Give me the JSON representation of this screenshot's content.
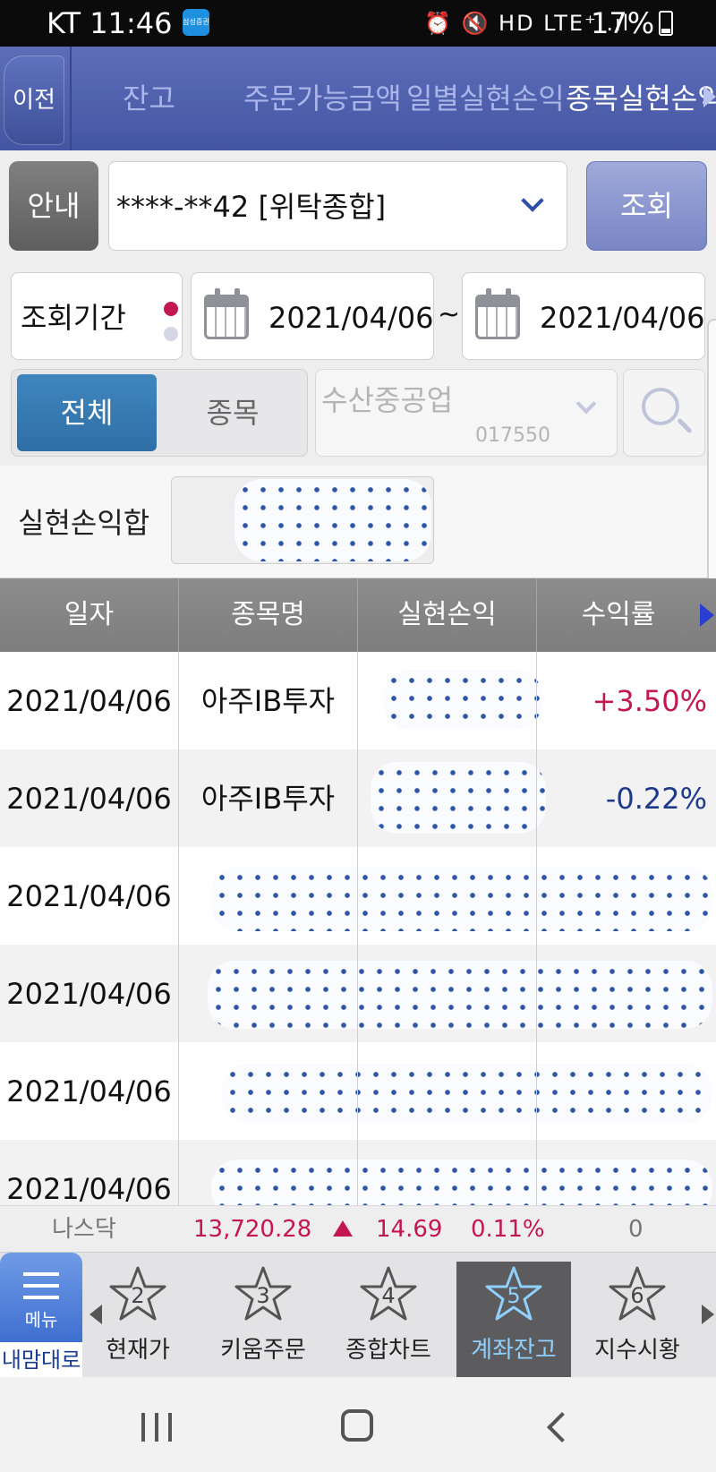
{
  "status_bar": {
    "carrier_time": "KT 11:46",
    "notification_label": "삼성증권",
    "icons": "⏰ 🔇 HD LTE⁺ .ıl",
    "battery": "17%"
  },
  "top_nav": {
    "back_label": "이전",
    "tabs": [
      {
        "label": "잔고",
        "active": false
      },
      {
        "label": "주문가능금액",
        "active": false
      },
      {
        "label": "일별실현손익",
        "active": false
      },
      {
        "label": "종목실현손익",
        "active": true
      }
    ]
  },
  "account": {
    "guide_label": "안내",
    "value": "****-**42 [위탁종합]",
    "query_label": "조회"
  },
  "period": {
    "label": "조회기간",
    "start_date": "2021/04/06",
    "separator": "~",
    "end_date": "2021/04/06"
  },
  "filter": {
    "all_label": "전체",
    "stock_label": "종목",
    "stock_name": "수산중공업",
    "stock_code": "017550"
  },
  "summary": {
    "label": "실현손익합"
  },
  "table": {
    "headers": [
      "일자",
      "종목명",
      "실현손익",
      "수익률"
    ],
    "rows": [
      {
        "date": "2021/04/06",
        "name": "아주IB투자",
        "rate": "+3.50%",
        "rate_color": "#c2174f"
      },
      {
        "date": "2021/04/06",
        "name": "아주IB투자",
        "rate": "-0.22%",
        "rate_color": "#1f3a8a"
      },
      {
        "date": "2021/04/06",
        "name": "",
        "rate": "",
        "rate_color": "#111111"
      },
      {
        "date": "2021/04/06",
        "name": "",
        "rate": "",
        "rate_color": "#111111"
      },
      {
        "date": "2021/04/06",
        "name": "",
        "rate": "",
        "rate_color": "#111111"
      },
      {
        "date": "2021/04/06",
        "name": "",
        "rate": "",
        "rate_color": "#111111"
      }
    ]
  },
  "ticker": {
    "name": "나스닥",
    "value": "13,720.28",
    "change": "14.69",
    "percent": "0.11%",
    "volume": "0",
    "up_color": "#c2174f"
  },
  "bottom_tabs": {
    "menu_label": "메뉴",
    "menu_sub": "내맘대로",
    "tabs": [
      {
        "num": "2",
        "label": "현재가",
        "active": false
      },
      {
        "num": "3",
        "label": "키움주문",
        "active": false
      },
      {
        "num": "4",
        "label": "종합차트",
        "active": false
      },
      {
        "num": "5",
        "label": "계좌잔고",
        "active": true
      },
      {
        "num": "6",
        "label": "지수시황",
        "active": false
      }
    ]
  },
  "colors": {
    "nav_blue": "#4455a3",
    "positive": "#c2174f",
    "negative": "#1f3a8a",
    "accent_active_tab": "#8fd0ff"
  }
}
